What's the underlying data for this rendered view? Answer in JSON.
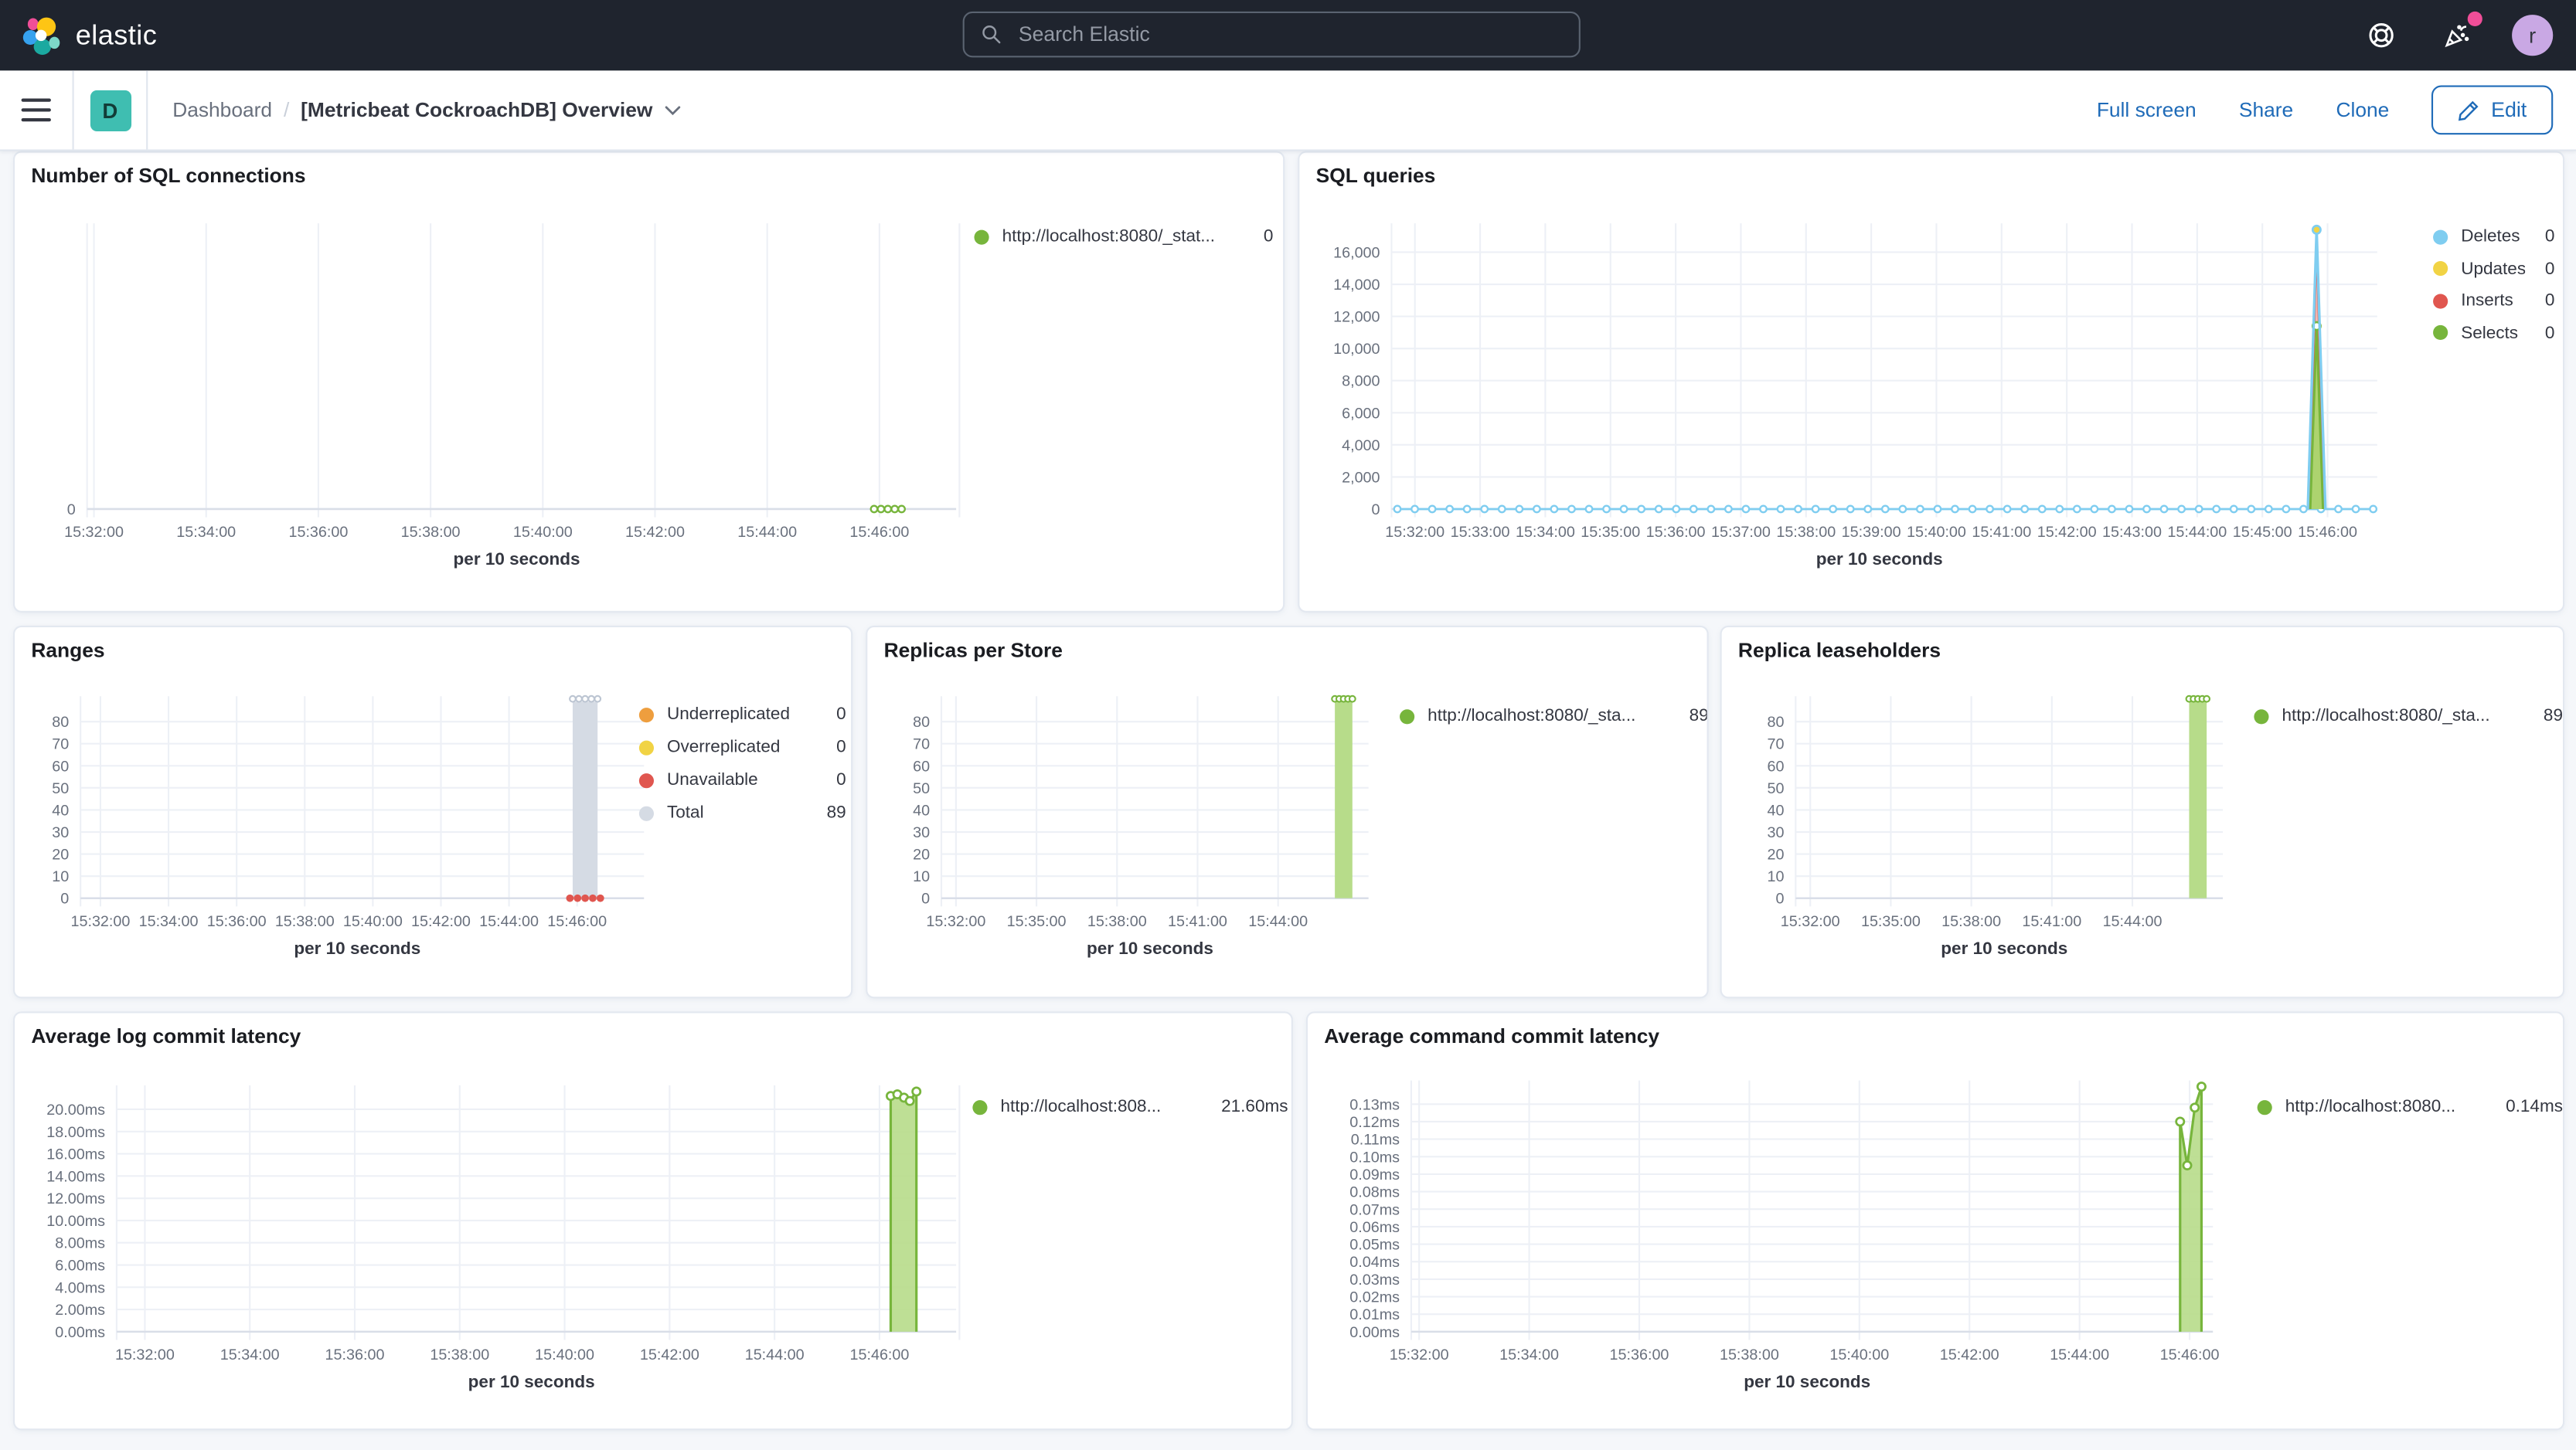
{
  "header": {
    "brand": "elastic",
    "search": {
      "placeholder": "Search Elastic"
    },
    "avatar_initial": "r"
  },
  "toolbar": {
    "app_badge": "D",
    "breadcrumb": {
      "app": "Dashboard",
      "separator": "/",
      "current": "[Metricbeat CockroachDB] Overview"
    },
    "actions": {
      "full_screen": "Full screen",
      "share": "Share",
      "clone": "Clone",
      "edit": "Edit"
    }
  },
  "colors": {
    "green": "#77B53C",
    "green_fill": "#B7DC8A",
    "blue": "#7FCDF0",
    "yellow": "#F1D344",
    "red": "#E0564F",
    "orange": "#EE9E3E",
    "gray_total": "#D5DBE4",
    "link_blue": "#1F6BB8",
    "brand_teal": "#3FBEB1",
    "notification_pink": "#F04E98",
    "topnav_bg": "#1F242E"
  },
  "chart_data": [
    {
      "id": "sql-connections",
      "type": "line",
      "title": "Number of SQL connections",
      "xlabel": "per 10 seconds",
      "x_range": [
        "15:31:30",
        "15:46:30"
      ],
      "x_ticks": [
        "15:32:00",
        "15:34:00",
        "15:36:00",
        "15:38:00",
        "15:40:00",
        "15:42:00",
        "15:44:00",
        "15:46:00"
      ],
      "y_ticks": [
        {
          "label": "0",
          "v": 0
        }
      ],
      "ylim": [
        0,
        1
      ],
      "legend": [
        {
          "label": "http://localhost:8080/_stat...",
          "value": "0",
          "color": "#77B53C"
        }
      ],
      "series": [
        {
          "name": "connections",
          "type": "dotline",
          "color": "#77B53C",
          "v": 0,
          "fx0": 0.916,
          "fx1": 0.948,
          "n": 5
        }
      ]
    },
    {
      "id": "sql-queries",
      "type": "line",
      "title": "SQL queries",
      "xlabel": "per 10 seconds",
      "x_range": [
        "15:31:30",
        "15:46:30"
      ],
      "x_ticks": [
        "15:32:00",
        "15:33:00",
        "15:34:00",
        "15:35:00",
        "15:36:00",
        "15:37:00",
        "15:38:00",
        "15:39:00",
        "15:40:00",
        "15:41:00",
        "15:42:00",
        "15:43:00",
        "15:44:00",
        "15:45:00",
        "15:46:00"
      ],
      "y_ticks": [
        {
          "label": "0",
          "v": 0
        },
        {
          "label": "2,000",
          "v": 2000
        },
        {
          "label": "4,000",
          "v": 4000
        },
        {
          "label": "6,000",
          "v": 6000
        },
        {
          "label": "8,000",
          "v": 8000
        },
        {
          "label": "10,000",
          "v": 10000
        },
        {
          "label": "12,000",
          "v": 12000
        },
        {
          "label": "14,000",
          "v": 14000
        },
        {
          "label": "16,000",
          "v": 16000
        }
      ],
      "ylim": [
        0,
        17800
      ],
      "legend": [
        {
          "label": "Deletes",
          "value": "0",
          "color": "#7FCDF0"
        },
        {
          "label": "Updates",
          "value": "0",
          "color": "#F1D344"
        },
        {
          "label": "Inserts",
          "value": "0",
          "color": "#E0564F"
        },
        {
          "label": "Selects",
          "value": "0",
          "color": "#77B53C"
        }
      ],
      "series": [
        {
          "name": "Deletes",
          "type": "dotline",
          "color": "#7FCDF0",
          "v": 0,
          "fx0": 0.006,
          "fx1": 1.006,
          "n": 57
        },
        {
          "name": "Inserts",
          "type": "area",
          "color": "#E0564F",
          "fill": "#F2B1AA",
          "op": 0.9,
          "points": [
            {
              "fx": 0.9405,
              "v": 0
            },
            {
              "fx": 0.948,
              "v": 17000
            },
            {
              "fx": 0.9555,
              "v": 0
            }
          ]
        },
        {
          "name": "Selects",
          "type": "area",
          "color": "#77B53C",
          "fill": "#A9D46C",
          "op": 0.95,
          "points": [
            {
              "fx": 0.9415,
              "v": 0
            },
            {
              "fx": 0.948,
              "v": 11400,
              "m": 1
            },
            {
              "fx": 0.9545,
              "v": 0
            }
          ]
        },
        {
          "name": "Deletes-spike",
          "type": "line",
          "color": "#7FCDF0",
          "w": 1.6,
          "points": [
            {
              "fx": 0.939,
              "v": 0
            },
            {
              "fx": 0.948,
              "v": 17400,
              "m": 1,
              "mfill": "#F1D344"
            },
            {
              "fx": 0.957,
              "v": 0
            }
          ]
        }
      ]
    },
    {
      "id": "ranges",
      "type": "bar",
      "title": "Ranges",
      "xlabel": "per 10 seconds",
      "x_range": [
        "15:31:30",
        "15:46:30"
      ],
      "x_ticks": [
        "15:32:00",
        "15:34:00",
        "15:36:00",
        "15:38:00",
        "15:40:00",
        "15:42:00",
        "15:44:00",
        "15:46:00"
      ],
      "y_ticks": [
        {
          "label": "0",
          "v": 0
        },
        {
          "label": "10",
          "v": 10
        },
        {
          "label": "20",
          "v": 20
        },
        {
          "label": "30",
          "v": 30
        },
        {
          "label": "40",
          "v": 40
        },
        {
          "label": "50",
          "v": 50
        },
        {
          "label": "60",
          "v": 60
        },
        {
          "label": "70",
          "v": 70
        },
        {
          "label": "80",
          "v": 80
        }
      ],
      "ylim": [
        0,
        91.5
      ],
      "legend": [
        {
          "label": "Underreplicated",
          "value": "0",
          "color": "#EE9E3E"
        },
        {
          "label": "Overreplicated",
          "value": "0",
          "color": "#F1D344"
        },
        {
          "label": "Unavailable",
          "value": "0",
          "color": "#E0564F"
        },
        {
          "label": "Total",
          "value": "89",
          "color": "#D5DBE4"
        }
      ],
      "series": [
        {
          "name": "Total",
          "type": "bar",
          "fill": "#D5DBE4",
          "fx0": 0.889,
          "fx1": 0.934,
          "v": 89,
          "markers": {
            "n": 5,
            "color": "#BCC5D2",
            "v": 90.3
          }
        },
        {
          "name": "Unavailable",
          "type": "dots",
          "color": "#E0564F",
          "v": 0,
          "fx0": 0.884,
          "fx1": 0.939,
          "n": 5,
          "r": 2.3
        }
      ]
    },
    {
      "id": "replicas-per-store",
      "type": "bar",
      "title": "Replicas per Store",
      "xlabel": "per 10 seconds",
      "x_range": [
        "15:31:30",
        "15:46:30"
      ],
      "x_ticks": [
        "15:32:00",
        "15:35:00",
        "15:38:00",
        "15:41:00",
        "15:44:00"
      ],
      "y_ticks": [
        {
          "label": "0",
          "v": 0
        },
        {
          "label": "10",
          "v": 10
        },
        {
          "label": "20",
          "v": 20
        },
        {
          "label": "30",
          "v": 30
        },
        {
          "label": "40",
          "v": 40
        },
        {
          "label": "50",
          "v": 50
        },
        {
          "label": "60",
          "v": 60
        },
        {
          "label": "70",
          "v": 70
        },
        {
          "label": "80",
          "v": 80
        }
      ],
      "ylim": [
        0,
        91.5
      ],
      "legend": [
        {
          "label": "http://localhost:8080/_sta...",
          "value": "89",
          "color": "#77B53C"
        }
      ],
      "series": [
        {
          "name": "replicas",
          "type": "bar",
          "fill": "#B7DC8A",
          "fx0": 0.943,
          "fx1": 0.985,
          "v": 89,
          "markers": {
            "n": 5,
            "color": "#77B53C",
            "v": 90.3
          }
        }
      ]
    },
    {
      "id": "replica-leaseholders",
      "type": "bar",
      "title": "Replica leaseholders",
      "xlabel": "per 10 seconds",
      "x_range": [
        "15:31:30",
        "15:46:30"
      ],
      "x_ticks": [
        "15:32:00",
        "15:35:00",
        "15:38:00",
        "15:41:00",
        "15:44:00"
      ],
      "y_ticks": [
        {
          "label": "0",
          "v": 0
        },
        {
          "label": "10",
          "v": 10
        },
        {
          "label": "20",
          "v": 20
        },
        {
          "label": "30",
          "v": 30
        },
        {
          "label": "40",
          "v": 40
        },
        {
          "label": "50",
          "v": 50
        },
        {
          "label": "60",
          "v": 60
        },
        {
          "label": "70",
          "v": 70
        },
        {
          "label": "80",
          "v": 80
        }
      ],
      "ylim": [
        0,
        91.5
      ],
      "legend": [
        {
          "label": "http://localhost:8080/_sta...",
          "value": "89",
          "color": "#77B53C"
        }
      ],
      "series": [
        {
          "name": "leaseholders",
          "type": "bar",
          "fill": "#B7DC8A",
          "fx0": 0.943,
          "fx1": 0.985,
          "v": 89,
          "markers": {
            "n": 5,
            "color": "#77B53C",
            "v": 90.3
          }
        }
      ]
    },
    {
      "id": "avg-log-commit-latency",
      "type": "area",
      "title": "Average log commit latency",
      "xlabel": "per 10 seconds",
      "x_range": [
        "15:31:30",
        "15:46:30"
      ],
      "x_ticks": [
        "15:32:00",
        "15:34:00",
        "15:36:00",
        "15:38:00",
        "15:40:00",
        "15:42:00",
        "15:44:00",
        "15:46:00"
      ],
      "y_ticks": [
        {
          "label": "0.00ms",
          "v": 0
        },
        {
          "label": "2.00ms",
          "v": 2
        },
        {
          "label": "4.00ms",
          "v": 4
        },
        {
          "label": "6.00ms",
          "v": 6
        },
        {
          "label": "8.00ms",
          "v": 8
        },
        {
          "label": "10.00ms",
          "v": 10
        },
        {
          "label": "12.00ms",
          "v": 12
        },
        {
          "label": "14.00ms",
          "v": 14
        },
        {
          "label": "16.00ms",
          "v": 16
        },
        {
          "label": "18.00ms",
          "v": 18
        },
        {
          "label": "20.00ms",
          "v": 20
        }
      ],
      "ylim": [
        0,
        22.15
      ],
      "legend": [
        {
          "label": "http://localhost:808...",
          "value": "21.60ms",
          "color": "#77B53C"
        }
      ],
      "series": [
        {
          "name": "log-latency",
          "type": "area",
          "color": "#77B53C",
          "fill": "#B7DC8A",
          "op": 0.9,
          "w": 1.5,
          "points": [
            {
              "fx": 0.933,
              "v": 21.2,
              "m": 1
            },
            {
              "fx": 0.941,
              "v": 21.35,
              "m": 1
            },
            {
              "fx": 0.949,
              "v": 21.05,
              "m": 1
            },
            {
              "fx": 0.956,
              "v": 20.75,
              "m": 1
            },
            {
              "fx": 0.964,
              "v": 21.6,
              "m": 1
            }
          ]
        }
      ]
    },
    {
      "id": "avg-command-commit-latency",
      "type": "area",
      "title": "Average command commit latency",
      "xlabel": "per 10 seconds",
      "x_range": [
        "15:31:30",
        "15:46:30"
      ],
      "x_ticks": [
        "15:32:00",
        "15:34:00",
        "15:36:00",
        "15:38:00",
        "15:40:00",
        "15:42:00",
        "15:44:00",
        "15:46:00"
      ],
      "y_ticks": [
        {
          "label": "0.00ms",
          "v": 0
        },
        {
          "label": "0.01ms",
          "v": 0.01
        },
        {
          "label": "0.02ms",
          "v": 0.02
        },
        {
          "label": "0.03ms",
          "v": 0.03
        },
        {
          "label": "0.04ms",
          "v": 0.04
        },
        {
          "label": "0.05ms",
          "v": 0.05
        },
        {
          "label": "0.06ms",
          "v": 0.06
        },
        {
          "label": "0.07ms",
          "v": 0.07
        },
        {
          "label": "0.08ms",
          "v": 0.08
        },
        {
          "label": "0.09ms",
          "v": 0.09
        },
        {
          "label": "0.10ms",
          "v": 0.1
        },
        {
          "label": "0.11ms",
          "v": 0.11
        },
        {
          "label": "0.12ms",
          "v": 0.12
        },
        {
          "label": "0.13ms",
          "v": 0.13
        }
      ],
      "ylim": [
        0,
        0.1435
      ],
      "legend": [
        {
          "label": "http://localhost:8080...",
          "value": "0.14ms",
          "color": "#77B53C"
        }
      ],
      "series": [
        {
          "name": "command-latency",
          "type": "area",
          "color": "#77B53C",
          "fill": "#B7DC8A",
          "op": 0.9,
          "w": 1.5,
          "points": [
            {
              "fx": 0.971,
              "v": 0.12,
              "m": 1
            },
            {
              "fx": 0.98,
              "v": 0.095,
              "m": 1
            },
            {
              "fx": 0.9895,
              "v": 0.128,
              "m": 1
            },
            {
              "fx": 0.998,
              "v": 0.14,
              "m": 1
            }
          ]
        }
      ]
    }
  ]
}
